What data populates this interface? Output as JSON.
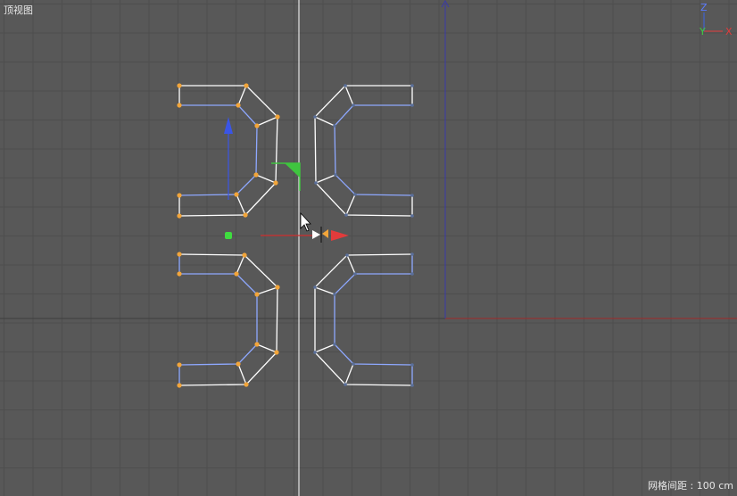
{
  "viewport": {
    "view_name": "顶视图",
    "grid_spacing_text": "网格间距 : 100 cm"
  },
  "axis_gizmo": {
    "z_label": "Z",
    "y_label": "Y",
    "x_label": "X",
    "colors": {
      "x": "#e23b3b",
      "y": "#3fcf3f",
      "z": "#3a63e6"
    }
  },
  "colors": {
    "background": "#585858",
    "grid_line": "#4e4e4e",
    "spline_white": "#ffffff",
    "spline_blue": "#8ea8ff",
    "selected_point": "#f2a53a",
    "unselected_point": "#5a6f9a",
    "world_axis_red": "#a02a2a",
    "world_axis_blue": "#3a3aa8",
    "mirror_line": "#ffffff",
    "move_handle_x": "#e23b3b",
    "move_handle_y": "#3a55e6",
    "move_handle_z": "#3fc43f"
  }
}
